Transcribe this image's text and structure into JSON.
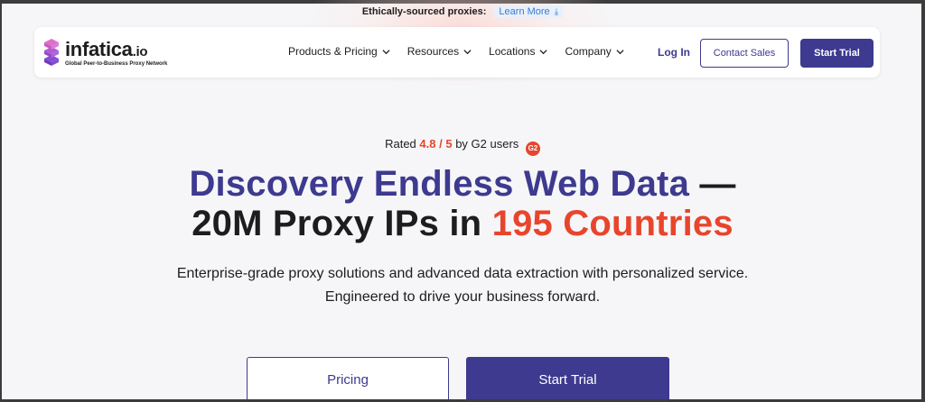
{
  "announcement": {
    "text": "Ethically-sourced proxies:",
    "link_label": "Learn More",
    "link_icon": "download-icon"
  },
  "brand": {
    "name": "infatica",
    "tld": ".io",
    "tagline": "Global Peer-to-Business Proxy Network",
    "colors": {
      "primary": "#3d3a8f",
      "accent": "#e8452c",
      "logo_purple": "#8c4bd6"
    }
  },
  "nav": {
    "items": [
      {
        "label": "Products & Pricing",
        "icon": "chevron-down-icon"
      },
      {
        "label": "Resources",
        "icon": "chevron-down-icon"
      },
      {
        "label": "Locations",
        "icon": "chevron-down-icon"
      },
      {
        "label": "Company",
        "icon": "chevron-down-icon"
      }
    ],
    "login_label": "Log In",
    "contact_label": "Contact Sales",
    "trial_label": "Start Trial"
  },
  "hero": {
    "rating_prefix": "Rated",
    "rating_score": "4.8 / 5",
    "rating_suffix": "by G2 users",
    "rating_badge": "G2",
    "headline_part1": "Discovery Endless Web Data",
    "headline_part2": " —",
    "headline_part3": "20M Proxy IPs in ",
    "headline_part4": "195 Countries",
    "subtitle_line1": "Enterprise-grade proxy solutions and advanced data extraction with personalized service.",
    "subtitle_line2": "Engineered to drive your business forward.",
    "pricing_label": "Pricing",
    "trial_label": "Start Trial"
  }
}
